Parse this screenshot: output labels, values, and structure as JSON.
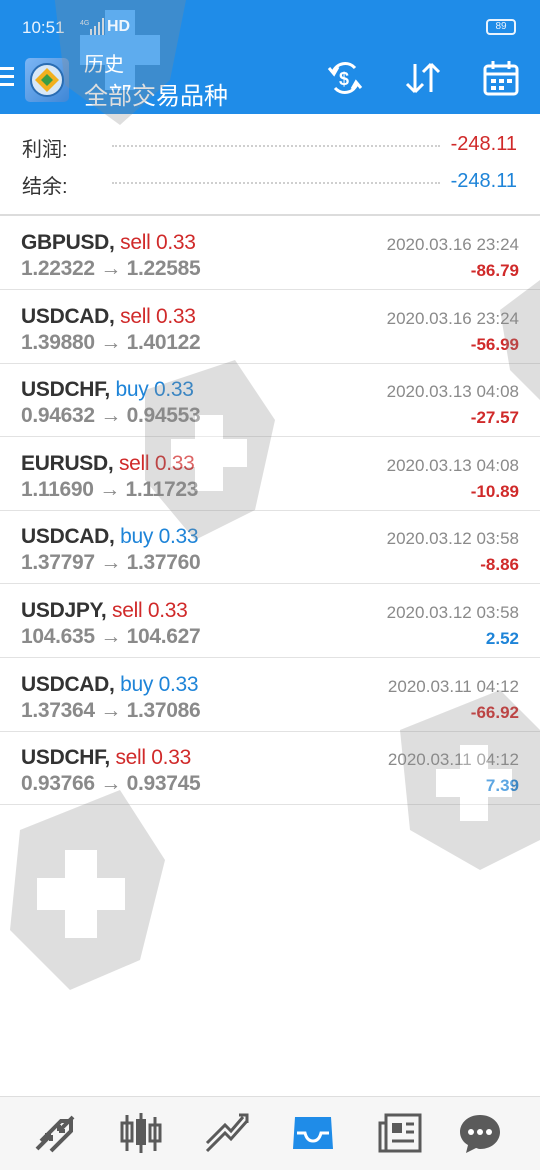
{
  "status": {
    "time": "10:51",
    "network": "4G",
    "hd": "HD",
    "battery": "89"
  },
  "header": {
    "subtitle": "历史",
    "title": "全部交易品种"
  },
  "summary": {
    "profit_label": "利润:",
    "profit_value": "-248.11",
    "balance_label": "结余:",
    "balance_value": "-248.11"
  },
  "trades": [
    {
      "symbol": "GBPUSD,",
      "type": "sell 0.33",
      "open": "1.22322",
      "close": "1.22585",
      "time": "2020.03.16 23:24",
      "profit": "-86.79"
    },
    {
      "symbol": "USDCAD,",
      "type": "sell 0.33",
      "open": "1.39880",
      "close": "1.40122",
      "time": "2020.03.16 23:24",
      "profit": "-56.99"
    },
    {
      "symbol": "USDCHF,",
      "type": "buy 0.33",
      "open": "0.94632",
      "close": "0.94553",
      "time": "2020.03.13 04:08",
      "profit": "-27.57"
    },
    {
      "symbol": "EURUSD,",
      "type": "sell 0.33",
      "open": "1.11690",
      "close": "1.11723",
      "time": "2020.03.13 04:08",
      "profit": "-10.89"
    },
    {
      "symbol": "USDCAD,",
      "type": "buy 0.33",
      "open": "1.37797",
      "close": "1.37760",
      "time": "2020.03.12 03:58",
      "profit": "-8.86"
    },
    {
      "symbol": "USDJPY,",
      "type": "sell 0.33",
      "open": "104.635",
      "close": "104.627",
      "time": "2020.03.12 03:58",
      "profit": "2.52"
    },
    {
      "symbol": "USDCAD,",
      "type": "buy 0.33",
      "open": "1.37364",
      "close": "1.37086",
      "time": "2020.03.11 04:12",
      "profit": "-66.92"
    },
    {
      "symbol": "USDCHF,",
      "type": "sell 0.33",
      "open": "0.93766",
      "close": "0.93745",
      "time": "2020.03.11 04:12",
      "profit": "7.39"
    }
  ],
  "arrow": "→",
  "colors": {
    "header_bg": "#1f8ce8",
    "loss": "#d02a2a",
    "gain": "#1e84d8",
    "active_nav": "#1f8ce8",
    "nav_icon": "#5a5a5a"
  },
  "bottom_nav": [
    "quotes-icon",
    "chart-icon",
    "trade-icon",
    "history-icon",
    "news-icon",
    "chat-icon"
  ]
}
